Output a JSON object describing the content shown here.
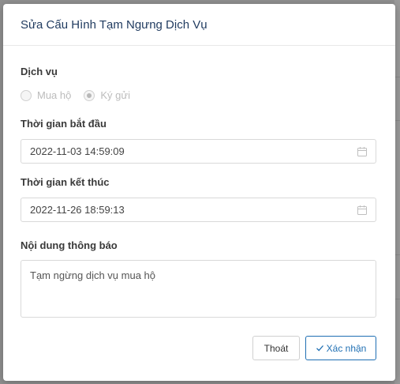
{
  "modal": {
    "title": "Sửa Cấu Hình Tạm Ngưng Dịch Vụ"
  },
  "service": {
    "label": "Dịch vụ",
    "options": [
      {
        "label": "Mua hộ",
        "checked": false
      },
      {
        "label": "Ký gửi",
        "checked": true
      }
    ]
  },
  "start_time": {
    "label": "Thời gian bắt đầu",
    "value": "2022-11-03 14:59:09"
  },
  "end_time": {
    "label": "Thời gian kết thúc",
    "value": "2022-11-26 18:59:13"
  },
  "notice": {
    "label": "Nội dung thông báo",
    "value": "Tạm ngừng dịch vụ mua hộ"
  },
  "buttons": {
    "cancel": "Thoát",
    "submit": "Xác nhận"
  },
  "colors": {
    "title": "#1f3a5f",
    "primary": "#1f6fb3"
  }
}
